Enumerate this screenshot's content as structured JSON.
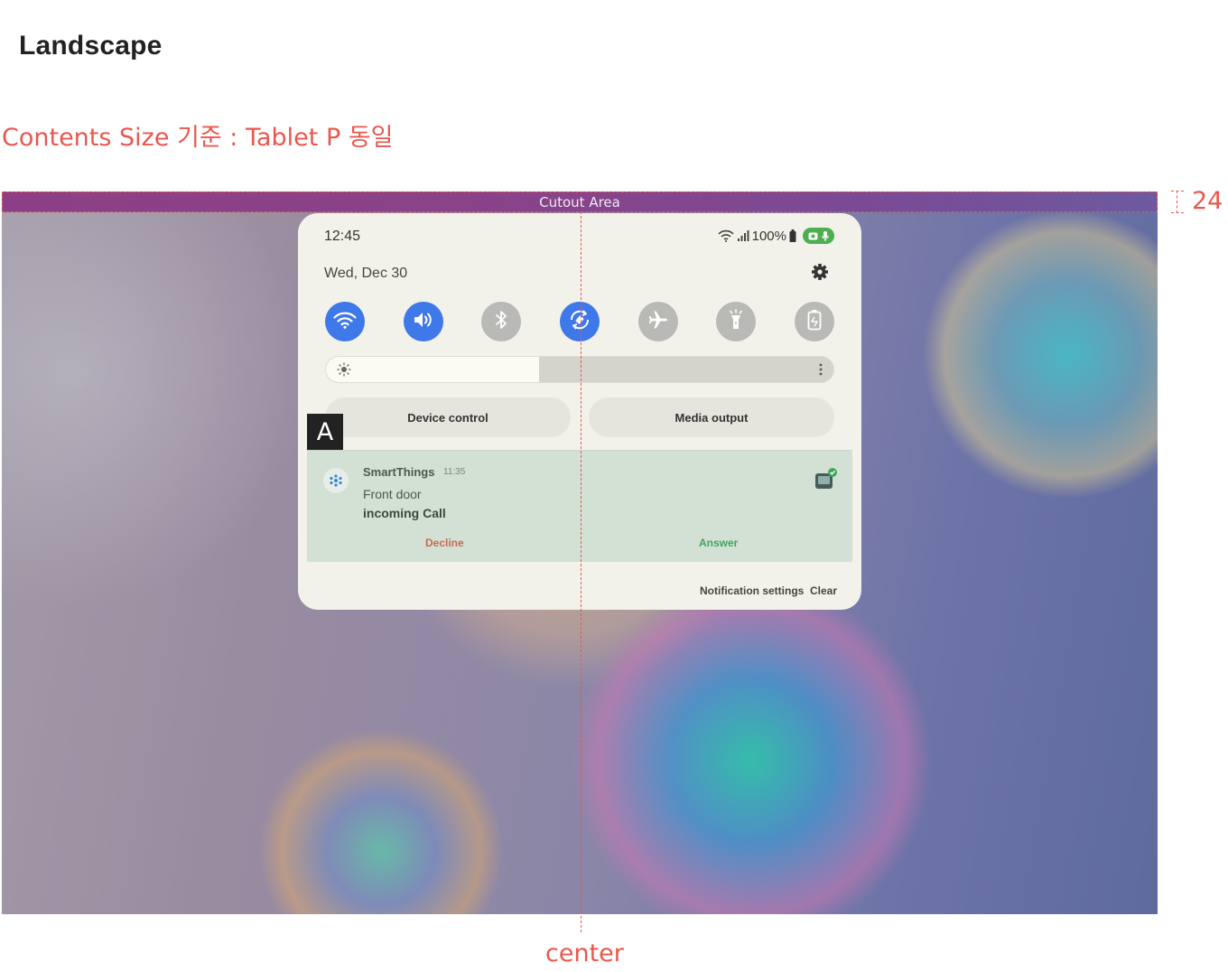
{
  "page": {
    "title": "Landscape",
    "subtitle": "Contents Size 기준 : Tablet P 동일",
    "cutout_label": "Cutout Area",
    "cutout_height_label": "24",
    "center_label": "center",
    "marker_label": "A"
  },
  "status_bar": {
    "time": "12:45",
    "date": "Wed, Dec 30",
    "battery_text": "100%",
    "icons": [
      "wifi-icon",
      "signal-icon",
      "battery-icon",
      "camera-icon",
      "mic-icon",
      "settings-icon"
    ]
  },
  "quick_toggles": [
    {
      "name": "wifi",
      "icon": "wifi-icon",
      "state": "on"
    },
    {
      "name": "sound",
      "icon": "sound-icon",
      "state": "on"
    },
    {
      "name": "bluetooth",
      "icon": "bluetooth-icon",
      "state": "off"
    },
    {
      "name": "auto-rotate",
      "icon": "auto-rotate-icon",
      "state": "on"
    },
    {
      "name": "airplane",
      "icon": "airplane-icon",
      "state": "off"
    },
    {
      "name": "flashlight",
      "icon": "flashlight-icon",
      "state": "off"
    },
    {
      "name": "power-saving",
      "icon": "power-saving-icon",
      "state": "off"
    }
  ],
  "brightness": {
    "level": 0.42
  },
  "buttons": {
    "device_control": "Device control",
    "media_output": "Media output"
  },
  "notification": {
    "app_name": "SmartThings",
    "time": "11:35",
    "line1": "Front door",
    "line2": "incoming Call",
    "decline": "Decline",
    "answer": "Answer"
  },
  "footer": {
    "notification_settings": "Notification settings",
    "clear": "Clear"
  },
  "colors": {
    "accent_annotation": "#e8584f",
    "toggle_on": "#3f78e8",
    "toggle_off": "#b9b9b5",
    "decline": "#c96a4e",
    "answer": "#3fa65c"
  }
}
